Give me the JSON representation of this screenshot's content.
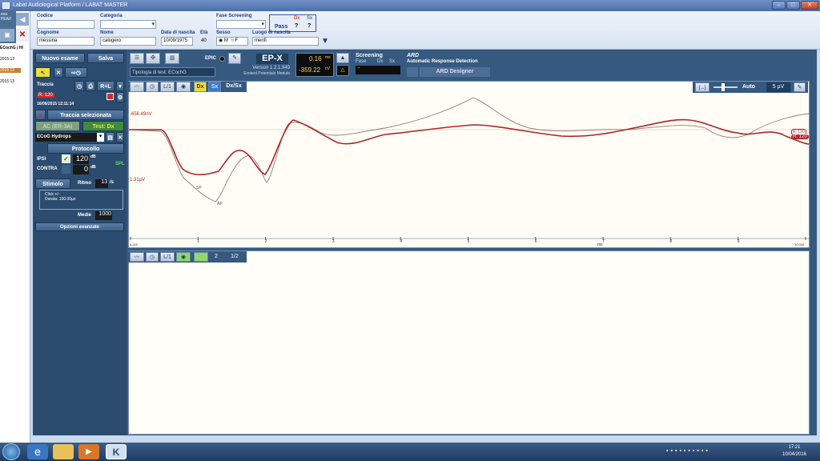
{
  "window": {
    "title": "Labat Audiological Platform / LABAT MASTER",
    "buttons": [
      "–",
      "□",
      "✕"
    ]
  },
  "patient": {
    "labels": {
      "codice": "Codice",
      "categoria": "Categoria",
      "fase_screening": "Fase Screening",
      "cognome": "Cognome",
      "nome": "Nome",
      "data_nascita": "Data di nascita",
      "eta": "Età",
      "sesso": "Sesso",
      "luogo": "Luogo di nascita",
      "pass": "Pass",
      "dx": "Dx",
      "sx": "Sx"
    },
    "codice": "",
    "categoria": "",
    "fase_screening": "",
    "cognome": "messina",
    "nome": "calogero",
    "data_nascita": "10/09/1975",
    "eta": "40",
    "sesso_m": "M",
    "sesso_f": "F",
    "luogo": "menfi",
    "pass_dx": "?",
    "pass_sx": "?"
  },
  "left_strip": {
    "top_label": "esa\nPEA/I",
    "tab": "ECochG | HI",
    "items": [
      "2015 13",
      "2015 13",
      "2015 13"
    ]
  },
  "side": {
    "nuovo_esame": "Nuovo esame",
    "salva": "Salva",
    "traccia": "Traccia",
    "rl": "R+L",
    "r_tag": "R: 120",
    "date": "16/06/2015 12:11:14",
    "traccia_selezionata": "Traccia selezionata",
    "ac_label": "AC (ER-3A)",
    "test_dx": "Test: Dx",
    "protocol_select": "ECoG Hydrops",
    "protocollo": "Protocollo",
    "ipsi": "IPSI",
    "ipsi_val": "120",
    "contra": "CONTRA",
    "contra_val": "0",
    "db": "dB",
    "spl": "SPL",
    "stimolo": "Stimolo",
    "ritmo": "Ritmo",
    "ritmo_val": "13",
    "ritmo_unit": "/s",
    "stim_line1": "Click +/-",
    "stim_line2": "Durata: 100.00µs",
    "medie": "Medie",
    "medie_val": "1000",
    "opzioni": "Opzioni avanzate"
  },
  "toolbar": {
    "tipologia": "Tipologia di test: ECochG",
    "epic": "EPIC",
    "epx": "EP-X",
    "version": "Version 1.2.1.949",
    "module": "Evoked Potentials Module",
    "ms_val": "0.16",
    "ms_unit": "ms",
    "nv_val": "-359.22",
    "nv_unit": "nV",
    "screening": "Screening",
    "fase": "Fase",
    "dx": "Dx",
    "sx": "Sx",
    "screen_val": "-",
    "ard": "ARD",
    "ard_desc": "Automatic Response Detection",
    "ard_designer": "ARD Designer"
  },
  "graph1": {
    "buttons": [
      "L/1",
      "Dx",
      "Sx",
      "Dx/Sx"
    ],
    "zoom_label": "[...]",
    "auto": "Auto",
    "scale": "5 µV",
    "y_top": "-656.49nV",
    "y_mid": "1.31µV",
    "x_labels": [
      "0.000",
      "1",
      "2",
      "3",
      "4",
      "5",
      "6",
      "7",
      "8",
      "9",
      "10.000"
    ],
    "x_unit": "ms",
    "markers": [
      "SP",
      "AP"
    ],
    "trace_labels": [
      "R: 120",
      "R: 120"
    ],
    "colors": {
      "dark": "#b0242a",
      "light": "#9a7a72"
    }
  },
  "graph2": {
    "buttons": [
      "L/1",
      "1",
      "2",
      "1/2"
    ]
  },
  "taskbar": {
    "time": "17:21",
    "date": "10/04/2016"
  }
}
